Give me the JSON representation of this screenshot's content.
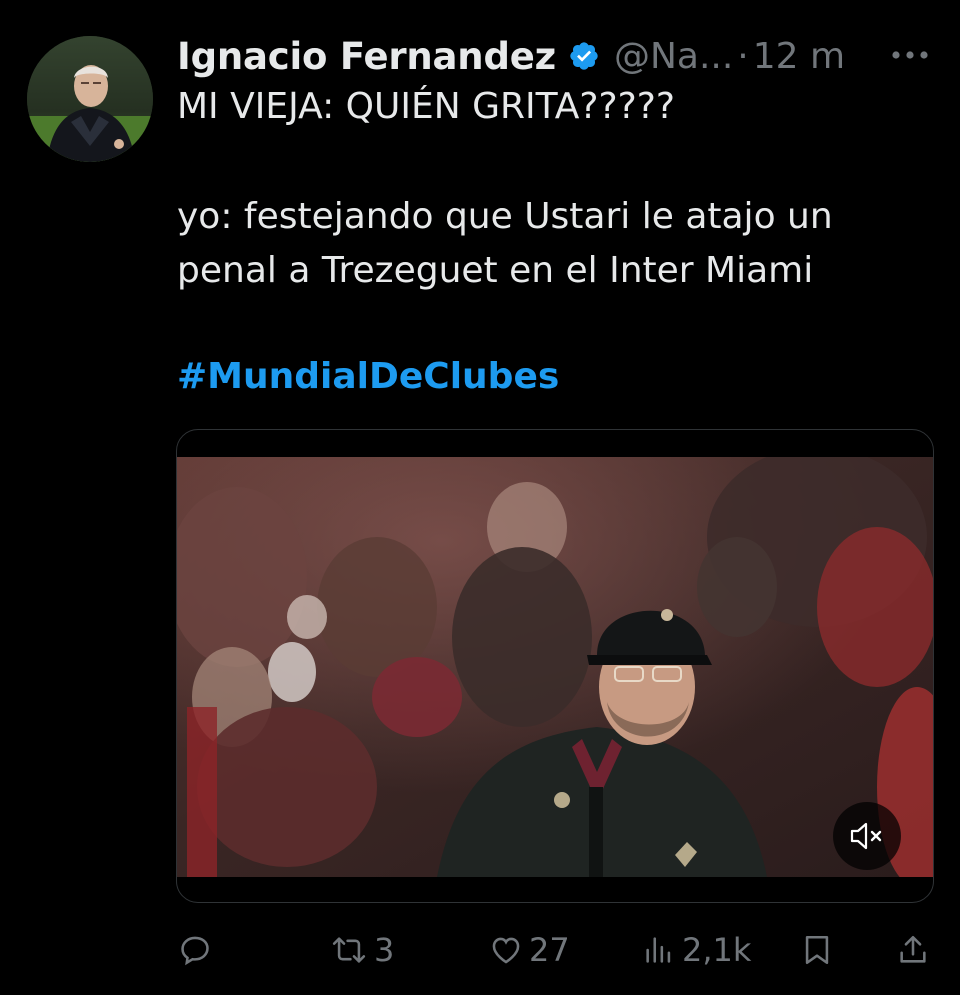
{
  "tweet": {
    "author": {
      "display_name": "Ignacio Fernandez",
      "handle": "@Na...",
      "time": "12 m",
      "verified_icon": "verified-badge-icon"
    },
    "text_lines": [
      "MI VIEJA: QUIÉN GRITA?????",
      "yo: festejando que Ustari le atajo un",
      "penal a Trezeguet en el Inter Miami"
    ],
    "hashtag": "#MundialDeClubes",
    "media": {
      "type": "video",
      "muted_icon": "speaker-muted-icon"
    },
    "actions": {
      "reply": {
        "icon": "reply-icon",
        "count": ""
      },
      "retweet": {
        "icon": "retweet-icon",
        "count": "3"
      },
      "like": {
        "icon": "heart-icon",
        "count": "27"
      },
      "views": {
        "icon": "views-chart-icon",
        "count": "2,1k"
      },
      "bookmark": {
        "icon": "bookmark-icon"
      },
      "share": {
        "icon": "share-icon"
      }
    }
  },
  "colors": {
    "background": "#000000",
    "text": "#e7e9ea",
    "secondary": "#71767b",
    "accent": "#1d9bf0"
  }
}
